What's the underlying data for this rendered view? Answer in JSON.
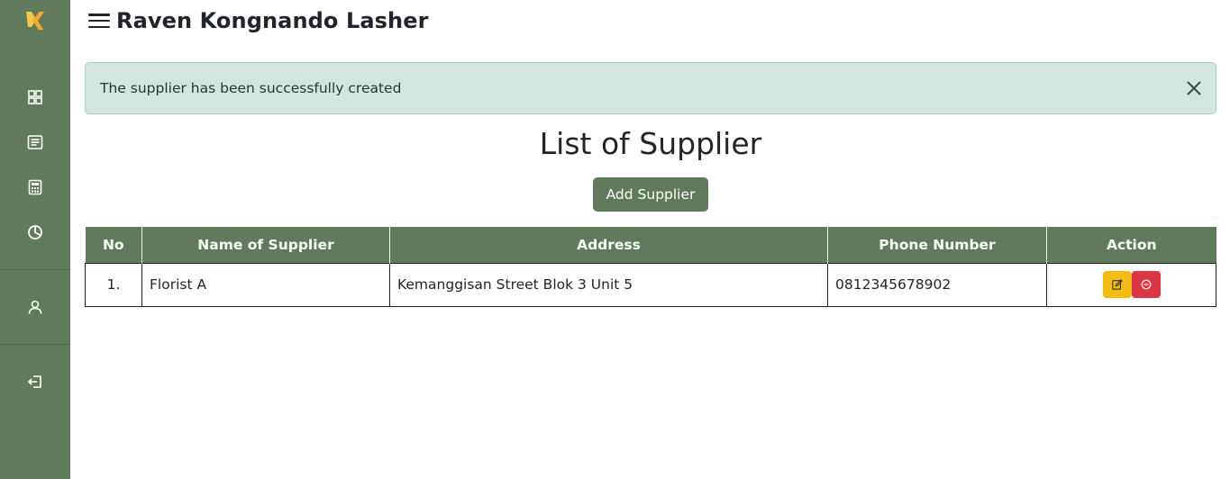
{
  "header": {
    "user_name": "Raven Kongnando Lasher"
  },
  "alert": {
    "message": "The supplier has been successfully created"
  },
  "page": {
    "title": "List of Supplier",
    "add_button": "Add Supplier"
  },
  "table": {
    "headers": [
      "No",
      "Name of Supplier",
      "Address",
      "Phone Number",
      "Action"
    ],
    "rows": [
      {
        "no": "1.",
        "name": "Florist A",
        "address": "Kemanggisan Street Blok 3 Unit 5",
        "phone": "0812345678902"
      }
    ]
  },
  "colors": {
    "primary": "#617a5c",
    "alert_bg": "#d2e6dd",
    "edit": "#f5bd14",
    "delete": "#dc3545",
    "logo": "#f2c94c"
  },
  "icons": {
    "sidebar": [
      "dashboard-grid-icon",
      "document-list-icon",
      "calculator-icon",
      "pie-chart-icon",
      "user-icon",
      "logout-icon"
    ],
    "row_actions": [
      "edit-icon",
      "delete-icon"
    ]
  }
}
